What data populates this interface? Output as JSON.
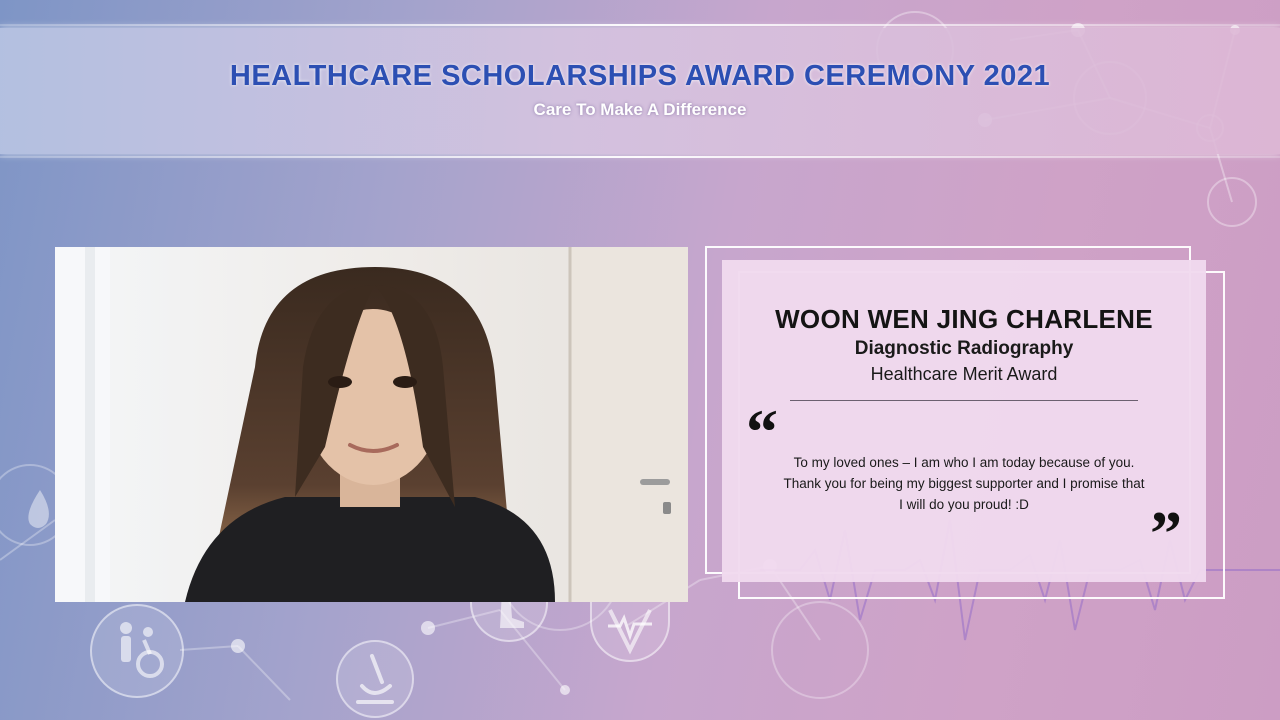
{
  "event": {
    "title": "HEALTHCARE SCHOLARSHIPS AWARD CEREMONY 2021",
    "subtitle": "Care To Make A Difference"
  },
  "awardee": {
    "name": "WOON WEN JING CHARLENE",
    "course": "Diagnostic Radiography",
    "award": "Healthcare Merit Award",
    "quote": "To my loved ones – I am who I am today because of you. Thank you for being my biggest supporter and I promise that I will do you proud! :D"
  },
  "icons": [
    "wheelchair-icon",
    "microscope-icon",
    "heart-ecg-icon",
    "prosthetic-leg-icon",
    "blood-drop-icon"
  ],
  "colors": {
    "title_blue": "#2c4fb3",
    "card_bg": "#f0daee",
    "text_dark": "#141414"
  }
}
